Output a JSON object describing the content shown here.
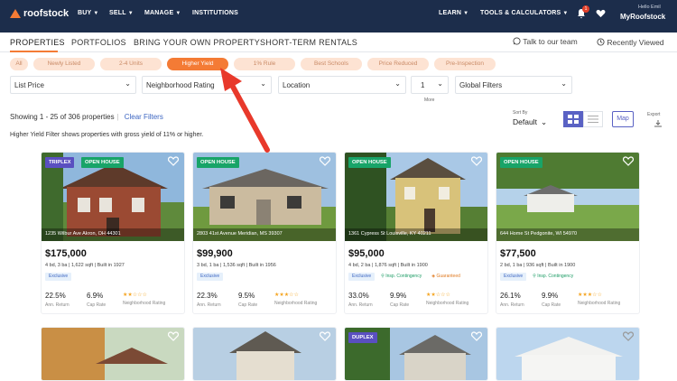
{
  "brand": {
    "name": "roofstock"
  },
  "nav": {
    "buy": "BUY",
    "sell": "SELL",
    "manage": "MANAGE",
    "institutions": "INSTITUTIONS",
    "learn": "LEARN",
    "tools": "TOOLS & CALCULATORS",
    "notifications_count": "1",
    "hello": "Hello Emil",
    "account": "MyRoofstock"
  },
  "tabs": [
    "PROPERTIES",
    "PORTFOLIOS",
    "BRING YOUR OWN PROPERTY",
    "SHORT-TERM RENTALS"
  ],
  "talk": "Talk to our team",
  "recent": "Recently Viewed",
  "chips": [
    "All",
    "Newly Listed",
    "2-4 Units",
    "Higher Yield",
    "1% Rule",
    "Best Schools",
    "Price Reduced",
    "Pre-Inspection"
  ],
  "filters": {
    "price": "List Price",
    "neighborhood": "Neighborhood Rating",
    "location": "Location",
    "more_value": "1",
    "more_label": "More",
    "global": "Global Filters"
  },
  "results": {
    "showing": "Showing 1 - 25 of 306 properties",
    "clear": "Clear Filters",
    "note": "Higher Yield Filter shows properties with gross yield of 11% or higher."
  },
  "sort": {
    "label": "Sort By",
    "value": "Default"
  },
  "map_label": "Map",
  "export_label": "Export",
  "cards": [
    {
      "tags": [
        "TRIPLEX",
        "OPEN HOUSE"
      ],
      "address": "1235 Wilbur Ave Akron, OH 44301",
      "price": "$175,000",
      "specs": "4 bd, 3 ba | 1,622 sqft | Built in 1927",
      "pills": [
        "Exclusive"
      ],
      "ret": "22.5%",
      "cap": "6.9%",
      "ret_label": "Ann. Return",
      "cap_label": "Cap Rate",
      "nh_label": "Neighborhood Rating",
      "stars": "★★☆☆☆"
    },
    {
      "tags": [
        "OPEN HOUSE"
      ],
      "address": "2803 41st Avenue Meridian, MS 39307",
      "price": "$99,900",
      "specs": "3 bd, 1 ba | 1,536 sqft | Built in 1956",
      "pills": [
        "Exclusive"
      ],
      "ret": "22.3%",
      "cap": "9.5%",
      "ret_label": "Ann. Return",
      "cap_label": "Cap Rate",
      "nh_label": "Neighborhood Rating",
      "stars": "★★★☆☆"
    },
    {
      "tags": [
        "OPEN HOUSE"
      ],
      "address": "1361 Cypress St Louisville, KY 40211",
      "price": "$95,000",
      "specs": "4 bd, 2 ba | 1,876 sqft | Built in 1900",
      "pills": [
        "Exclusive",
        "Insp. Contingency",
        "Guaranteed"
      ],
      "ret": "33.0%",
      "cap": "9.9%",
      "ret_label": "Ann. Return",
      "cap_label": "Cap Rate",
      "nh_label": "Neighborhood Rating",
      "stars": "★★☆☆☆"
    },
    {
      "tags": [
        "OPEN HOUSE"
      ],
      "address": "644 Home St Pedgonite, WI 54970",
      "price": "$77,500",
      "specs": "2 bd, 1 ba | 936 sqft | Built in 1900",
      "pills": [
        "Exclusive",
        "Insp. Contingency"
      ],
      "ret": "26.1%",
      "cap": "9.9%",
      "ret_label": "Ann. Return",
      "cap_label": "Cap Rate",
      "nh_label": "Neighborhood Rating",
      "stars": "★★★☆☆"
    }
  ],
  "row2_tags": [
    "DUPLEX"
  ],
  "colors": {
    "nav_bg": "#1c2d4b",
    "accent": "#f47b35",
    "chip": "#fde3d3",
    "view_active": "#5a62c4",
    "open_house": "#18a468",
    "type_tag": "#5a4fc0",
    "arrow": "#e8392b"
  }
}
